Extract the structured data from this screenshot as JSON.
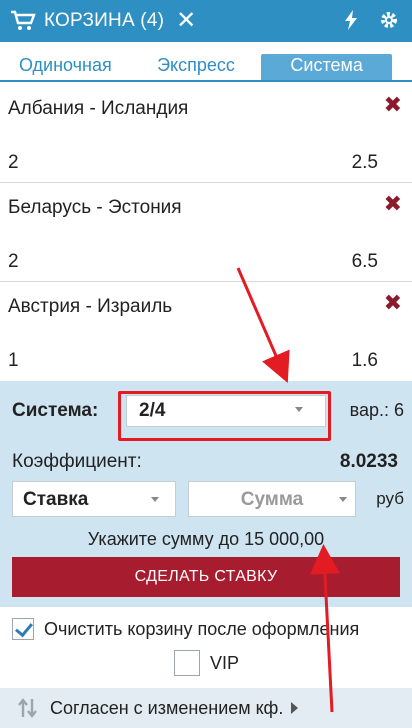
{
  "header": {
    "title": "КОРЗИНА (4)",
    "close_icon": "close-icon",
    "cart_icon": "cart-icon",
    "lightning_icon": "lightning-icon",
    "gear_icon": "gear-icon"
  },
  "tabs": [
    {
      "label": "Одиночная",
      "active": false
    },
    {
      "label": "Экспресс",
      "active": false
    },
    {
      "label": "Система",
      "active": true
    }
  ],
  "bets": [
    {
      "name": "Албания - Исландия",
      "count": "2",
      "odds": "2.5"
    },
    {
      "name": "Беларусь - Эстония",
      "count": "2",
      "odds": "6.5"
    },
    {
      "name": "Австрия - Израиль",
      "count": "1",
      "odds": "1.6"
    }
  ],
  "system": {
    "label": "Система:",
    "selected": "2/4",
    "variants": "вар.: 6"
  },
  "coefficient": {
    "label": "Коэффициент:",
    "value": "8.0233"
  },
  "stake": {
    "type_selected": "Ставка",
    "amount_placeholder": "Сумма",
    "currency": "руб"
  },
  "hint": "Укажите сумму до 15 000,00",
  "submit_label": "СДЕЛАТЬ СТАВКУ",
  "options": {
    "clear_cart": {
      "label": "Очистить корзину после оформления",
      "checked": true
    },
    "vip": {
      "label": "VIP",
      "checked": false
    }
  },
  "footer": {
    "label": "Согласен с изменением кф."
  },
  "colors": {
    "brand": "#2d8fc2",
    "panel": "#cfe4f1",
    "submit": "#a81c30",
    "annotation": "#e31b23"
  }
}
